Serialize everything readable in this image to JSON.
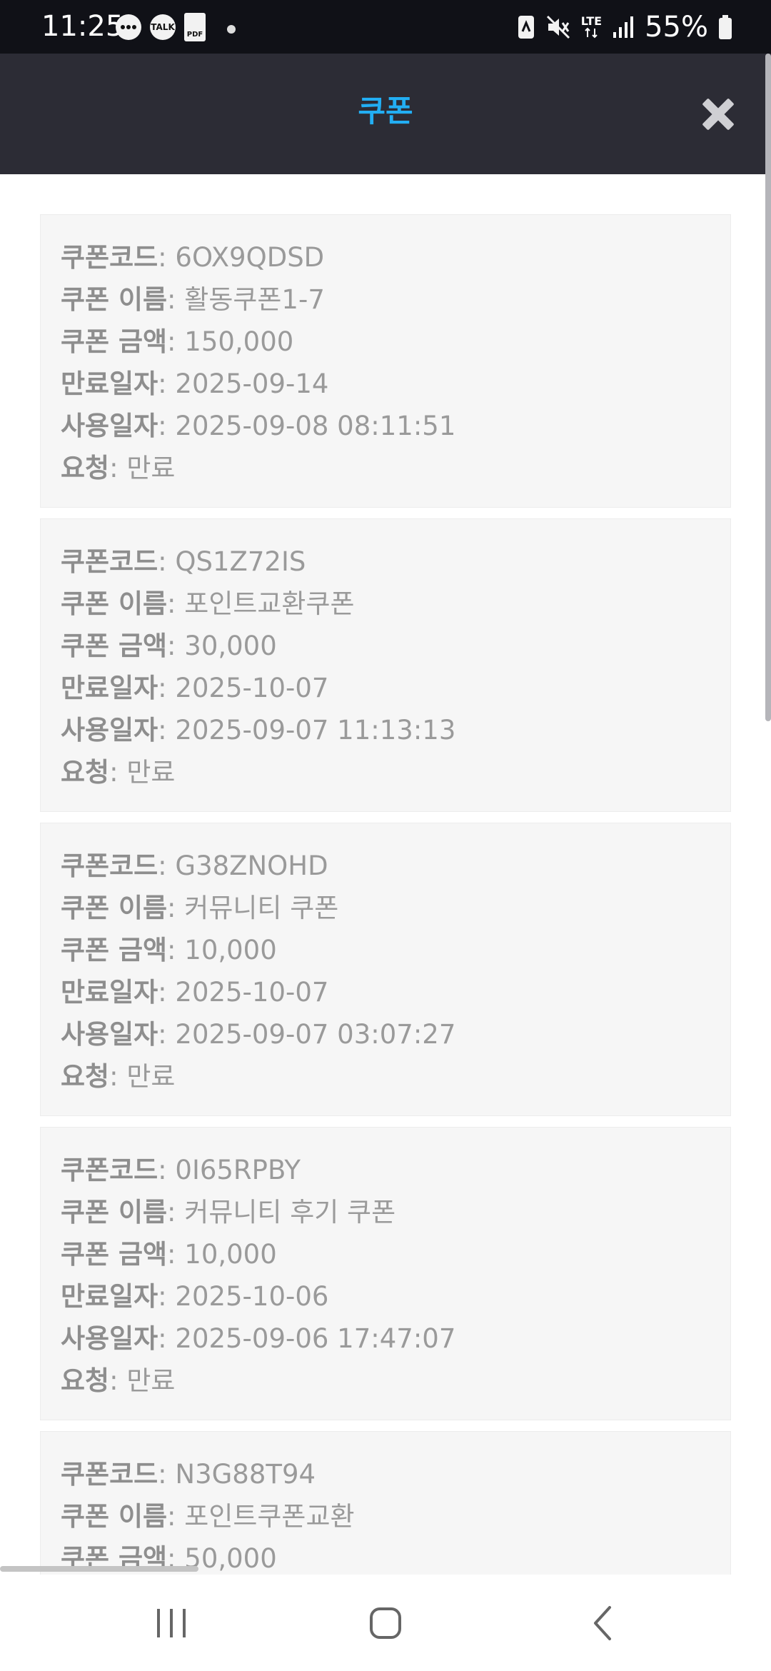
{
  "status_bar": {
    "time": "11:25",
    "notification_icons": [
      "message-icon",
      "kakaotalk-icon",
      "pdf-icon",
      "dot-icon"
    ],
    "talk_label": "TALK",
    "pdf_label": "PDF",
    "lte_label": "LTE",
    "battery_percent": "55%"
  },
  "header": {
    "title": "쿠폰",
    "title_color": "#22aef3",
    "close_icon": "close-icon"
  },
  "labels": {
    "code": "쿠폰코드",
    "name": "쿠폰 이름",
    "amount": "쿠폰 금액",
    "expiry": "만료일자",
    "used": "사용일자",
    "request": "요청"
  },
  "coupons": [
    {
      "code": ": 6OX9QDSD",
      "name": ": 활동쿠폰1-7",
      "amount": ": 150,000",
      "expiry": ": 2025-09-14",
      "used": ": 2025-09-08 08:11:51",
      "request": ": 만료"
    },
    {
      "code": ": QS1Z72IS",
      "name": ": 포인트교환쿠폰",
      "amount": ": 30,000",
      "expiry": ": 2025-10-07",
      "used": ": 2025-09-07 11:13:13",
      "request": ": 만료"
    },
    {
      "code": ": G38ZNOHD",
      "name": ": 커뮤니티 쿠폰",
      "amount": ": 10,000",
      "expiry": ": 2025-10-07",
      "used": ": 2025-09-07 03:07:27",
      "request": ": 만료"
    },
    {
      "code": ": 0I65RPBY",
      "name": ": 커뮤니티 후기 쿠폰",
      "amount": ": 10,000",
      "expiry": ": 2025-10-06",
      "used": ": 2025-09-06 17:47:07",
      "request": ": 만료"
    },
    {
      "code": ": N3G88T94",
      "name": ": 포인트쿠폰교환",
      "amount": ": 50,000"
    }
  ],
  "nav_bar": {
    "buttons": [
      "recents-icon",
      "home-icon",
      "back-icon"
    ]
  }
}
